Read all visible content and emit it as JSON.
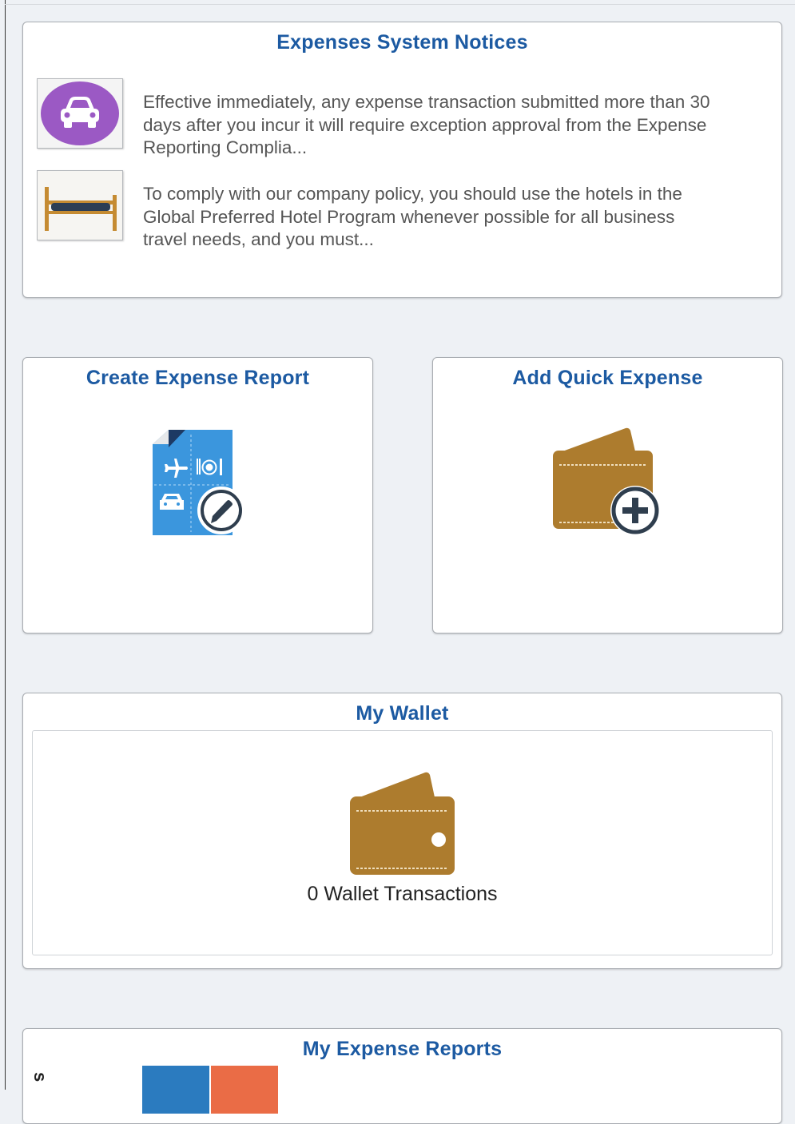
{
  "notices": {
    "title": "Expenses System Notices",
    "items": [
      {
        "icon": "car-icon",
        "text": "Effective immediately, any expense transaction submitted more than 30 days after you incur it will require exception approval from the Expense Reporting Complia..."
      },
      {
        "icon": "bed-icon",
        "text": "To comply with our company policy, you should use the hotels in the Global Preferred Hotel Program whenever possible for all business travel needs, and you must..."
      }
    ]
  },
  "create_report": {
    "title": "Create Expense Report",
    "icon": "expense-report-edit-icon"
  },
  "quick_expense": {
    "title": "Add Quick Expense",
    "icon": "wallet-add-icon"
  },
  "wallet": {
    "title": "My Wallet",
    "icon": "wallet-icon",
    "count_label": "0 Wallet Transactions"
  },
  "my_reports": {
    "title": "My Expense Reports",
    "axis_label_partial": "s"
  },
  "colors": {
    "title_blue": "#1c5aa2",
    "car_purple": "#9b59c4",
    "wallet_brown": "#ad7c2e",
    "report_blue": "#3b96dd",
    "chart_blue": "#2b7bbf",
    "chart_orange": "#ea6c46"
  }
}
